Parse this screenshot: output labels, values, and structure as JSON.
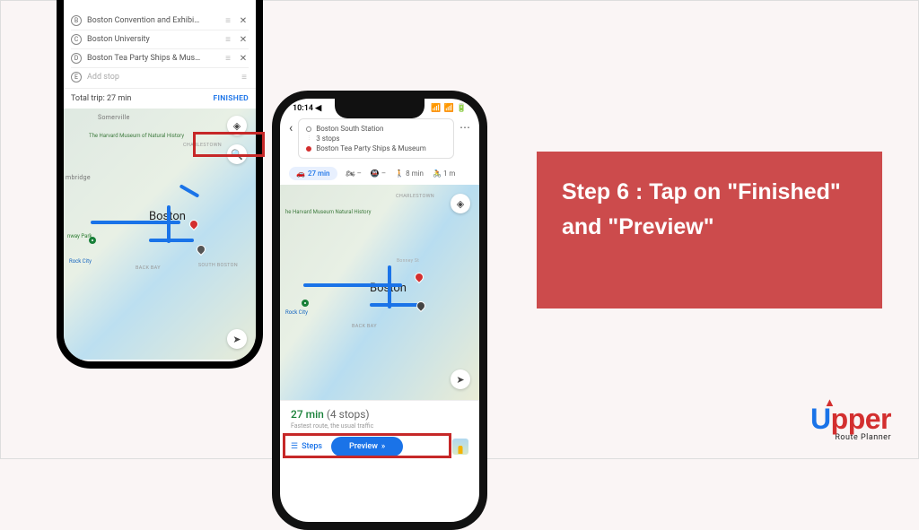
{
  "phone1": {
    "stops": [
      {
        "letter": "B",
        "name": "Boston Convention and Exhibi…"
      },
      {
        "letter": "C",
        "name": "Boston University"
      },
      {
        "letter": "D",
        "name": "Boston Tea Party Ships & Mus…"
      },
      {
        "letter": "E",
        "name": "Add stop"
      }
    ],
    "totalTrip": "Total trip: 27 min",
    "finished": "FINISHED",
    "map": {
      "city": "Boston",
      "somerville": "Somerville",
      "cambridge": "mbridge",
      "charlestown": "CHARLESTOWN",
      "backbay": "BACK BAY",
      "southboston": "SOUTH BOSTON",
      "fenway": "nway Park",
      "museum": "The Harvard Museum\nof Natural History",
      "rockcity": "Rock City"
    }
  },
  "phone2": {
    "statusTime": "10:14 ◀",
    "route": {
      "start": "Boston South Station",
      "middle": "3 stops",
      "end": "Boston Tea Party Ships & Museum"
    },
    "modes": {
      "car": "27 min",
      "walk": "8 min",
      "other": "1 m"
    },
    "map": {
      "city": "Boston",
      "charlestown": "CHARLESTOWN",
      "backbay": "BACK BAY",
      "museum": "he Harvard Museum\nNatural History",
      "rockcity": "Rock City",
      "bonney": "Bonney St"
    },
    "sheet": {
      "time": "27 min",
      "stops": "(4 stops)",
      "sub": "Fastest route, the usual traffic",
      "steps": "Steps",
      "preview": "Preview"
    }
  },
  "instruction": "Step 6 : Tap on \"Finished\" and \"Preview\"",
  "logo": {
    "brand_u": "U",
    "brand_rest": "pper",
    "sub": "Route Planner"
  }
}
